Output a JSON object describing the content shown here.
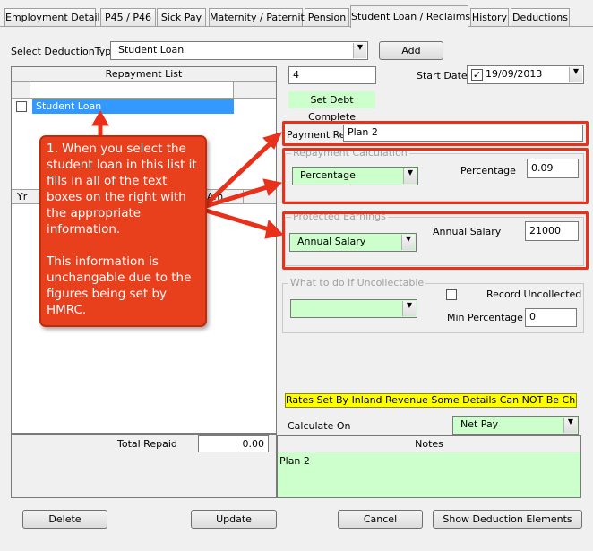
{
  "tabs": [
    {
      "label": "Employment Details",
      "active": false
    },
    {
      "label": "P45 / P46",
      "active": false
    },
    {
      "label": "Sick Pay",
      "active": false
    },
    {
      "label": "Maternity / Paternity",
      "active": false
    },
    {
      "label": "Pension",
      "active": false
    },
    {
      "label": "Student Loan / Reclaims",
      "active": true
    },
    {
      "label": "History",
      "active": false
    },
    {
      "label": "Deductions",
      "active": false
    }
  ],
  "deduction": {
    "select_label": "Select DeductionType",
    "selected": "Student Loan",
    "add_label": "Add"
  },
  "repayment_list": {
    "header": "Repayment List",
    "items": [
      "Student Loan"
    ],
    "columns": [
      "Yr",
      "Am"
    ]
  },
  "right": {
    "number_value": "4",
    "start_date_label": "Start Date",
    "start_date_value": "19/09/2013",
    "start_date_checked": true,
    "set_debt_complete": "Set Debt Complete",
    "payment_ref_label": "Payment Ref",
    "payment_ref_value": "Plan 2",
    "repayment_calc_caption": "Repayment Calculation",
    "repayment_calc_value": "Percentage",
    "percentage_label": "Percentage",
    "percentage_value": "0.09",
    "protected_caption": "Protected Earnings",
    "protected_value": "Annual Salary",
    "annual_salary_label": "Annual Salary",
    "annual_salary_value": "21000",
    "uncollectable_caption": "What to do if Uncollectable",
    "uncollectable_value": "",
    "record_uncollected_label": "Record Uncollected",
    "min_percentage_label": "Min Percentage",
    "min_percentage_value": "0",
    "rates_notice": "Rates Set By Inland Revenue Some Details Can NOT Be Changed",
    "calculate_on_label": "Calculate On",
    "calculate_on_value": "Net Pay"
  },
  "totals": {
    "total_repaid_label": "Total Repaid",
    "total_repaid_value": "0.00"
  },
  "notes": {
    "header": "Notes",
    "text": "Plan 2"
  },
  "buttons": {
    "delete": "Delete",
    "update": "Update",
    "cancel": "Cancel",
    "show_elements": "Show Deduction Elements"
  },
  "callout": {
    "para1": "1. When you select the student loan in this list it fills in all of the text boxes on the right with the appropriate information.",
    "para2": "This information is unchangable due to the figures being set by HMRC."
  },
  "colors": {
    "annotation_red": "#e8401c",
    "field_green": "#ccffcc",
    "selection_blue": "#3399ff",
    "notice_yellow": "#ffff00"
  }
}
